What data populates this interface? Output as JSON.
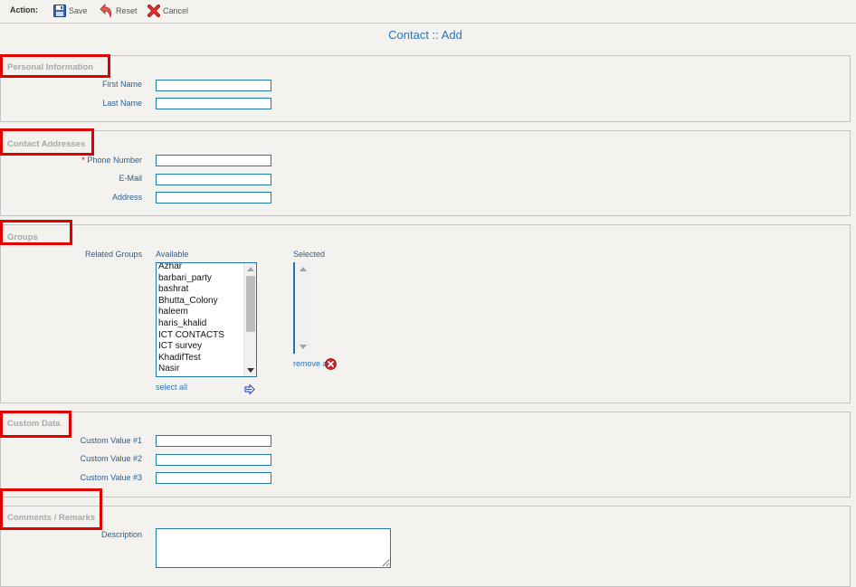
{
  "toolbar": {
    "action_label": "Action:",
    "save_label": "Save",
    "reset_label": "Reset",
    "cancel_label": "Cancel"
  },
  "page_title": "Contact :: Add",
  "sections": {
    "personal": {
      "title": "Personal Information",
      "first_name_label": "First Name",
      "last_name_label": "Last Name",
      "first_name_value": "",
      "last_name_value": ""
    },
    "addresses": {
      "title": "Contact Addresses",
      "phone_required_mark": "*",
      "phone_label": "Phone Number",
      "email_label": "E-Mail",
      "address_label": "Address",
      "phone_value": "",
      "email_value": "",
      "address_value": ""
    },
    "groups": {
      "title": "Groups",
      "related_label": "Related Groups",
      "available_label": "Available",
      "selected_label": "Selected",
      "available_items": [
        "Azhar",
        "barbari_party",
        "bashrat",
        "Bhutta_Colony",
        "haleem",
        "haris_khalid",
        "ICT CONTACTS",
        "ICT survey",
        "KhadifTest",
        "Nasir"
      ],
      "select_all_label": "select all",
      "remove_all_label": "remove all"
    },
    "custom": {
      "title": "Custom Data",
      "value1_label": "Custom Value #1",
      "value2_label": "Custom Value #2",
      "value3_label": "Custom Value #3"
    },
    "comments": {
      "title": "Comments / Remarks",
      "description_label": "Description",
      "description_value": ""
    }
  },
  "colors": {
    "highlight": "#e00000",
    "link": "#2b76b8",
    "label": "#2b5f93",
    "section_title": "#a8a8a8",
    "background": "#f3f2ee"
  },
  "icons": {
    "save": "floppy-disk-icon",
    "reset": "undo-arrow-icon",
    "cancel": "red-x-icon",
    "select_all": "arrow-right-icon",
    "remove_all": "red-x-circle-icon"
  }
}
